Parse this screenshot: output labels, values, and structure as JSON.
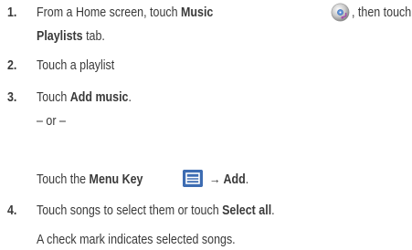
{
  "steps": [
    {
      "number": "1.",
      "lines": [
        {
          "pre": "From a Home screen, touch ",
          "bold": "Music",
          "mid": "",
          "icon": "music-disc-icon",
          "post": ", then touch the"
        },
        {
          "bold": "Playlists",
          "post": " tab."
        }
      ]
    },
    {
      "number": "2.",
      "lines": [
        {
          "text": "Touch a playlist"
        }
      ]
    },
    {
      "number": "3.",
      "lines": [
        {
          "pre": "Touch ",
          "bold": "Add music",
          "post": "."
        },
        {
          "text": "– or –"
        },
        {
          "pre": "Touch the ",
          "bold": "Menu Key",
          "icon": "menu-key-icon",
          "post_bold": "→ Add",
          "post": "."
        }
      ]
    },
    {
      "number": "4.",
      "lines": [
        {
          "pre": "Touch songs to select them or touch ",
          "bold": "Select all",
          "post": "."
        },
        {
          "text": "A check mark indicates selected songs."
        }
      ]
    }
  ]
}
